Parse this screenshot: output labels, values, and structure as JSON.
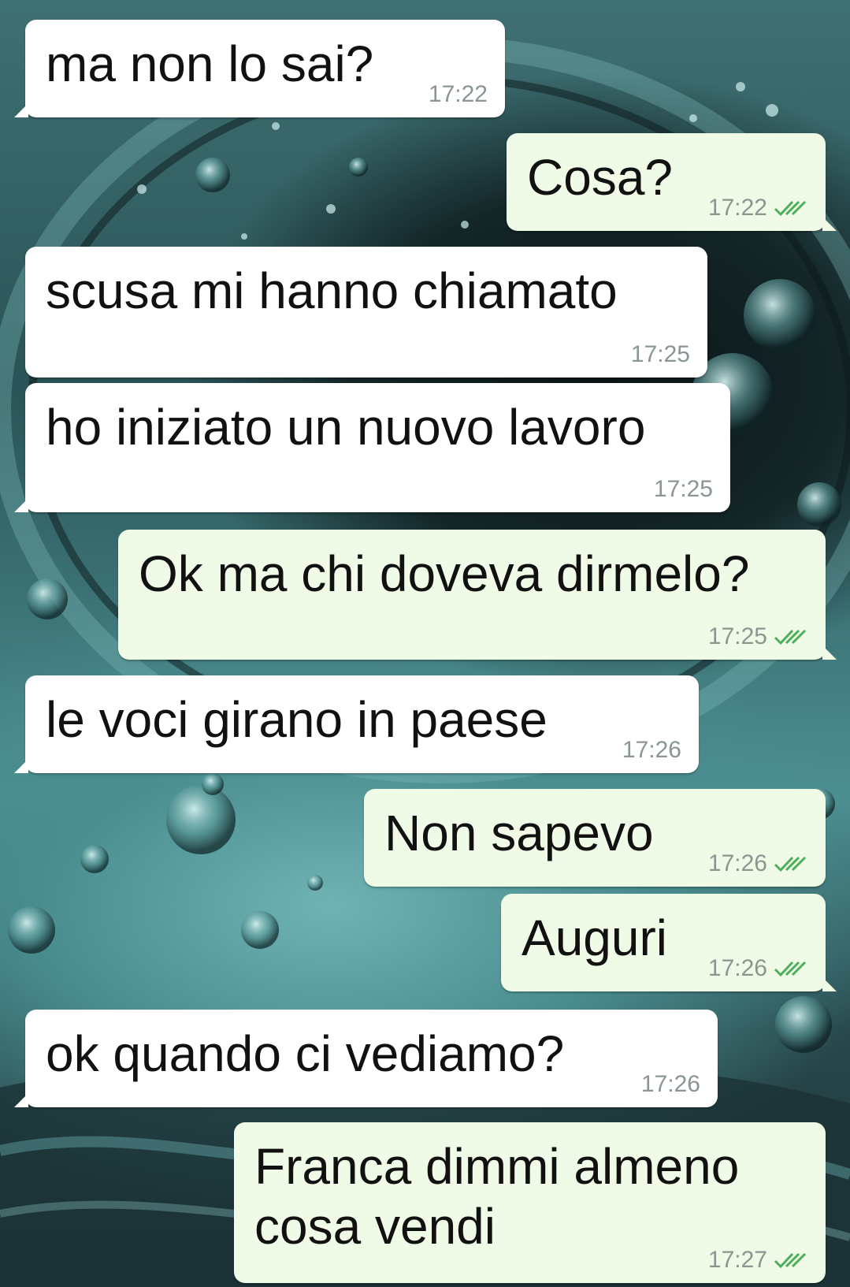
{
  "messages": [
    {
      "id": 0,
      "direction": "in",
      "text": "ma non lo sai?",
      "time": "17:22"
    },
    {
      "id": 1,
      "direction": "out",
      "text": "Cosa?",
      "time": "17:22",
      "status": "read-double-check-icon"
    },
    {
      "id": 2,
      "direction": "in",
      "text": "scusa mi hanno chiamato",
      "time": "17:25"
    },
    {
      "id": 3,
      "direction": "in",
      "text": "ho iniziato un nuovo lavoro",
      "time": "17:25"
    },
    {
      "id": 4,
      "direction": "out",
      "text": "Ok ma chi doveva dirmelo?",
      "time": "17:25",
      "status": "read-double-check-icon"
    },
    {
      "id": 5,
      "direction": "in",
      "text": "le voci girano in paese",
      "time": "17:26"
    },
    {
      "id": 6,
      "direction": "out",
      "text": "Non sapevo",
      "time": "17:26",
      "status": "read-double-check-icon"
    },
    {
      "id": 7,
      "direction": "out",
      "text": "Auguri",
      "time": "17:26",
      "status": "read-double-check-icon"
    },
    {
      "id": 8,
      "direction": "in",
      "text": "ok quando ci vediamo?",
      "time": "17:26"
    },
    {
      "id": 9,
      "direction": "out",
      "text": "Franca dimmi almeno\ncosa vendi",
      "time": "17:27",
      "status": "read-double-check-icon"
    }
  ],
  "colors": {
    "incoming_bubble": "#ffffff",
    "outgoing_bubble": "#effbe6",
    "timestamp": "#8a9690",
    "read_ticks": "#4fae5b"
  }
}
